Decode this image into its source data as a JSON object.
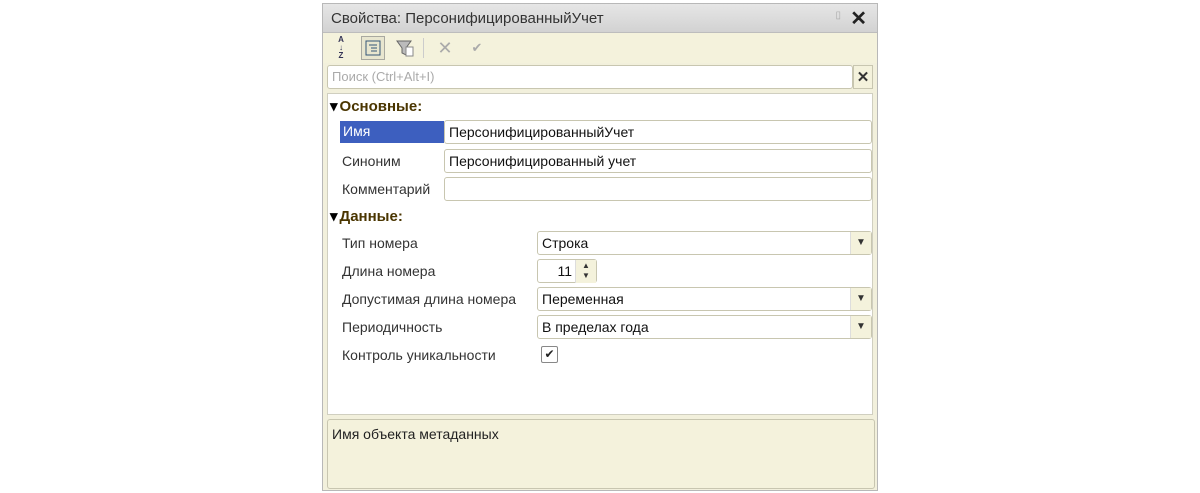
{
  "window": {
    "title": "Свойства: ПерсонифицированныйУчет"
  },
  "toolbar": {
    "sort": "A↓Z",
    "categories": "categories-icon",
    "filter": "filter-icon",
    "cancel": "✕",
    "confirm": "✔"
  },
  "search": {
    "placeholder": "Поиск (Ctrl+Alt+I)"
  },
  "groups": {
    "main": {
      "label": "Основные:",
      "name_label": "Имя",
      "name_value": "ПерсонифицированныйУчет",
      "synonym_label": "Синоним",
      "synonym_value": "Персонифицированный учет",
      "comment_label": "Комментарий",
      "comment_value": ""
    },
    "data": {
      "label": "Данные:",
      "number_type_label": "Тип номера",
      "number_type_value": "Строка",
      "number_length_label": "Длина номера",
      "number_length_value": "11",
      "allowed_length_label": "Допустимая длина номера",
      "allowed_length_value": "Переменная",
      "periodicity_label": "Периодичность",
      "periodicity_value": "В пределах года",
      "uniqueness_label": "Контроль уникальности",
      "uniqueness_checked": true
    }
  },
  "description": "Имя объекта метаданных"
}
